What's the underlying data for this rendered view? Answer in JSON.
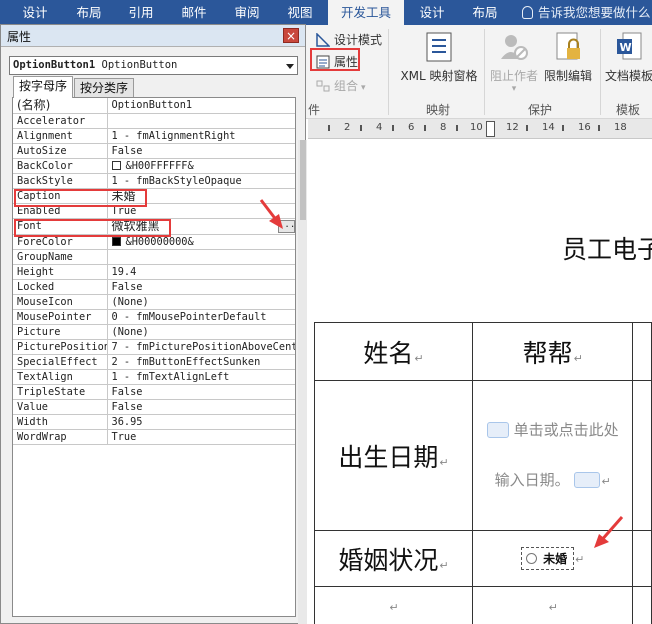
{
  "ribbon_tabs": [
    "设计",
    "布局",
    "引用",
    "邮件",
    "审阅",
    "视图",
    "开发工具",
    "设计",
    "布局"
  ],
  "tell_me": "告诉我您想要做什么",
  "ribbon": {
    "design_mode": "设计模式",
    "properties": "属性",
    "group_small": "组合",
    "group_label_controls": "件",
    "xml_mapping": "XML 映射窗格",
    "group_label_mapping": "映射",
    "block_authors": "阻止作者",
    "restrict_editing": "限制编辑",
    "group_label_protect": "保护",
    "doc_template": "文档模板",
    "group_label_template": "模板"
  },
  "ruler_numbers": [
    "2",
    "4",
    "6",
    "8",
    "10",
    "12",
    "14",
    "16",
    "18"
  ],
  "properties_window": {
    "title": "属性",
    "close_glyph": "×",
    "object_name": "OptionButton1",
    "object_type": "OptionButton",
    "tabs": [
      "按字母序",
      "按分类序"
    ],
    "rows": [
      {
        "name": "(名称)",
        "value": "OptionButton1"
      },
      {
        "name": "Accelerator",
        "value": ""
      },
      {
        "name": "Alignment",
        "value": "1 - fmAlignmentRight"
      },
      {
        "name": "AutoSize",
        "value": "False"
      },
      {
        "name": "BackColor",
        "value": "&H00FFFFFF&",
        "swatch": "#ffffff"
      },
      {
        "name": "BackStyle",
        "value": "1 - fmBackStyleOpaque"
      },
      {
        "name": "Caption",
        "value": "未婚"
      },
      {
        "name": "Enabled",
        "value": "True"
      },
      {
        "name": "Font",
        "value": "微软雅黑",
        "ellipsis": "..."
      },
      {
        "name": "ForeColor",
        "value": "&H00000000&",
        "swatch": "#000000"
      },
      {
        "name": "GroupName",
        "value": ""
      },
      {
        "name": "Height",
        "value": "19.4"
      },
      {
        "name": "Locked",
        "value": "False"
      },
      {
        "name": "MouseIcon",
        "value": "(None)"
      },
      {
        "name": "MousePointer",
        "value": "0 - fmMousePointerDefault"
      },
      {
        "name": "Picture",
        "value": "(None)"
      },
      {
        "name": "PicturePosition",
        "value": "7 - fmPicturePositionAboveCent"
      },
      {
        "name": "SpecialEffect",
        "value": "2 - fmButtonEffectSunken"
      },
      {
        "name": "TextAlign",
        "value": "1 - fmTextAlignLeft"
      },
      {
        "name": "TripleState",
        "value": "False"
      },
      {
        "name": "Value",
        "value": "False"
      },
      {
        "name": "Width",
        "value": "36.95"
      },
      {
        "name": "WordWrap",
        "value": "True"
      }
    ]
  },
  "document": {
    "title": "员工电子",
    "table": {
      "name_label": "姓名",
      "name_value": "帮帮",
      "dob_label": "出生日期",
      "dob_placeholder_1": "单击或点击此处",
      "dob_placeholder_2": "输入日期。",
      "marital_label": "婚姻状况",
      "option_caption": "未婚"
    }
  },
  "colors": {
    "ribbon_blue": "#2b579a",
    "highlight_red": "#e43b3b"
  }
}
